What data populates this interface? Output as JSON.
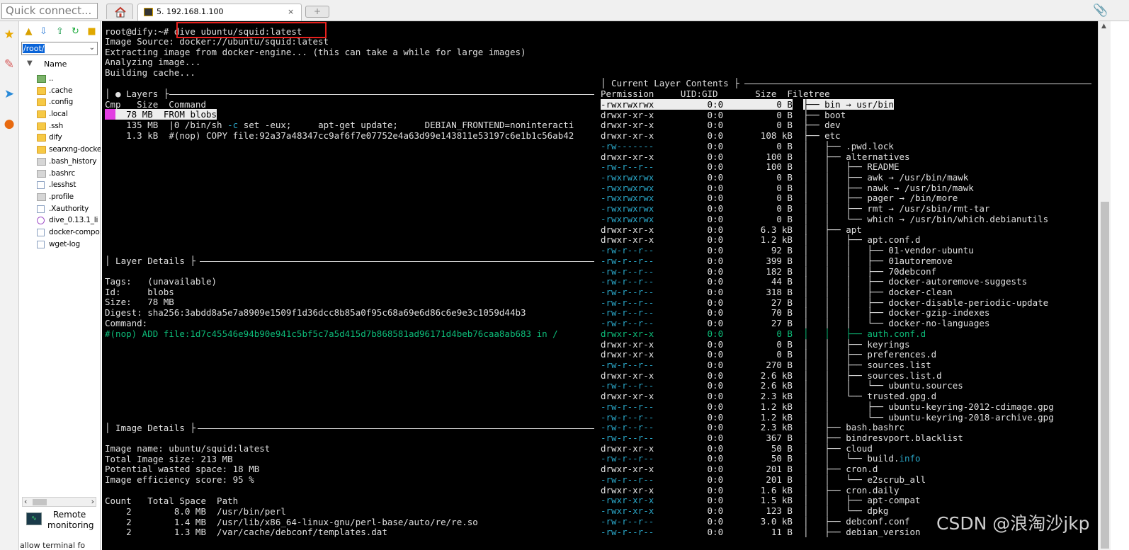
{
  "topbar": {
    "quick_connect_placeholder": "Quick connect...",
    "session_tab_label": "5. 192.168.1.100",
    "close_glyph": "×",
    "new_tab_glyph": "+",
    "attach_icon": "paperclip-icon"
  },
  "browser": {
    "path": "/root/",
    "column_header": "Name",
    "files": [
      {
        "name": "..",
        "kind": "up"
      },
      {
        "name": ".cache",
        "kind": "folder"
      },
      {
        "name": ".config",
        "kind": "folder"
      },
      {
        "name": ".local",
        "kind": "folder"
      },
      {
        "name": ".ssh",
        "kind": "folder"
      },
      {
        "name": "dify",
        "kind": "folder"
      },
      {
        "name": "searxng-docke",
        "kind": "folder"
      },
      {
        "name": ".bash_history",
        "kind": "filegray"
      },
      {
        "name": ".bashrc",
        "kind": "filegray"
      },
      {
        "name": ".lesshst",
        "kind": "doc"
      },
      {
        "name": ".profile",
        "kind": "filegray"
      },
      {
        "name": ".Xauthority",
        "kind": "doc"
      },
      {
        "name": "dive_0.13.1_li",
        "kind": "dive"
      },
      {
        "name": "docker-compo:",
        "kind": "doc"
      },
      {
        "name": "wget-log",
        "kind": "doc"
      }
    ],
    "remote_line1": "Remote",
    "remote_line2": "monitoring",
    "remote_cut": "allow terminal fo"
  },
  "terminal": {
    "prompt": "root@dify:~# ",
    "command": "dive ubuntu/squid:latest",
    "output": [
      "Image Source: docker://ubuntu/squid:latest",
      "Extracting image from docker-engine... (this can take a while for large images)",
      "Analyzing image...",
      "Building cache..."
    ],
    "layers_title": "│ ● Layers ├",
    "layers_header": "Cmp   Size  Command",
    "layers": [
      {
        "size": "  78 MB",
        "cmd": "FROM blobs"
      },
      {
        "size": " 135 MB",
        "cmd_pre": "|0 /bin/sh ",
        "cmd_flag": "-c",
        "cmd_post": " set -eux;     apt-get update;     DEBIAN_FRONTEND=noninteracti"
      },
      {
        "size": " 1.3 kB",
        "cmd": "#(nop) COPY file:92a37a48347cc9af6f7e07752e4a63d99e143811e53197c6e1b1c56ab42"
      }
    ],
    "layer_details_title": "│ Layer Details ├",
    "layer_details": [
      "Tags:   (unavailable)",
      "Id:     blobs",
      "Size:   78 MB",
      "Digest: sha256:3abdd8a5e7a8909e1509f1d36dcc8b85a0f95c68a69e6d86c6e9e3c1059d44b3",
      "Command:"
    ],
    "layer_command": "#(nop) ADD file:1d7c45546e94b90e941c5bf5c7a5d415d7b868581ad96171d4beb76caa8ab683 in /",
    "image_details_title": "│ Image Details ├",
    "image_details": [
      "Image name: ubuntu/squid:latest",
      "Total Image size: 213 MB",
      "Potential wasted space: 18 MB",
      "Image efficiency score: 95 %"
    ],
    "waste_header": "Count   Total Space  Path",
    "waste_rows": [
      "    2        8.0 MB  /usr/bin/perl",
      "    2        1.4 MB  /usr/lib/x86_64-linux-gnu/perl-base/auto/re/re.so",
      "    2        1.3 MB  /var/cache/debconf/templates.dat"
    ],
    "contents_title": "│ Current Layer Contents ├",
    "contents_header": "Permission     UID:GID       Size  Filetree",
    "contents_rows": [
      {
        "perm": "-rwxrwxrwx",
        "uid": "0:0",
        "size": "0 B",
        "tree": "├── bin → usr/bin",
        "style": "selected"
      },
      {
        "perm": "drwxr-xr-x",
        "uid": "0:0",
        "size": "0 B",
        "tree": "├── boot",
        "style": "normal"
      },
      {
        "perm": "drwxr-xr-x",
        "uid": "0:0",
        "size": "0 B",
        "tree": "├── dev",
        "style": "normal"
      },
      {
        "perm": "drwxr-xr-x",
        "uid": "0:0",
        "size": "108 kB",
        "tree": "├── etc",
        "style": "normal"
      },
      {
        "perm": "-rw-------",
        "uid": "0:0",
        "size": "0 B",
        "tree": "│   ├── .pwd.lock",
        "style": "cyan"
      },
      {
        "perm": "drwxr-xr-x",
        "uid": "0:0",
        "size": "100 B",
        "tree": "│   ├── alternatives",
        "style": "normal"
      },
      {
        "perm": "-rw-r--r--",
        "uid": "0:0",
        "size": "100 B",
        "tree": "│   │   ├── README",
        "style": "cyan"
      },
      {
        "perm": "-rwxrwxrwx",
        "uid": "0:0",
        "size": "0 B",
        "tree": "│   │   ├── awk → /usr/bin/mawk",
        "style": "cyan"
      },
      {
        "perm": "-rwxrwxrwx",
        "uid": "0:0",
        "size": "0 B",
        "tree": "│   │   ├── nawk → /usr/bin/mawk",
        "style": "cyan"
      },
      {
        "perm": "-rwxrwxrwx",
        "uid": "0:0",
        "size": "0 B",
        "tree": "│   │   ├── pager → /bin/more",
        "style": "cyan"
      },
      {
        "perm": "-rwxrwxrwx",
        "uid": "0:0",
        "size": "0 B",
        "tree": "│   │   ├── rmt → /usr/sbin/rmt-tar",
        "style": "cyan"
      },
      {
        "perm": "-rwxrwxrwx",
        "uid": "0:0",
        "size": "0 B",
        "tree": "│   │   └── which → /usr/bin/which.debianutils",
        "style": "cyan"
      },
      {
        "perm": "drwxr-xr-x",
        "uid": "0:0",
        "size": "6.3 kB",
        "tree": "│   ├── apt",
        "style": "normal"
      },
      {
        "perm": "drwxr-xr-x",
        "uid": "0:0",
        "size": "1.2 kB",
        "tree": "│   │   ├── apt.conf.d",
        "style": "normal"
      },
      {
        "perm": "-rw-r--r--",
        "uid": "0:0",
        "size": "92 B",
        "tree": "│   │   │   ├── 01-vendor-ubuntu",
        "style": "cyan"
      },
      {
        "perm": "-rw-r--r--",
        "uid": "0:0",
        "size": "399 B",
        "tree": "│   │   │   ├── 01autoremove",
        "style": "cyan"
      },
      {
        "perm": "-rw-r--r--",
        "uid": "0:0",
        "size": "182 B",
        "tree": "│   │   │   ├── 70debconf",
        "style": "cyan"
      },
      {
        "perm": "-rw-r--r--",
        "uid": "0:0",
        "size": "44 B",
        "tree": "│   │   │   ├── docker-autoremove-suggests",
        "style": "cyan"
      },
      {
        "perm": "-rw-r--r--",
        "uid": "0:0",
        "size": "318 B",
        "tree": "│   │   │   ├── docker-clean",
        "style": "cyan"
      },
      {
        "perm": "-rw-r--r--",
        "uid": "0:0",
        "size": "27 B",
        "tree": "│   │   │   ├── docker-disable-periodic-update",
        "style": "cyan"
      },
      {
        "perm": "-rw-r--r--",
        "uid": "0:0",
        "size": "70 B",
        "tree": "│   │   │   ├── docker-gzip-indexes",
        "style": "cyan"
      },
      {
        "perm": "-rw-r--r--",
        "uid": "0:0",
        "size": "27 B",
        "tree": "│   │   │   └── docker-no-languages",
        "style": "cyan"
      },
      {
        "perm": "drwxr-xr-x",
        "uid": "0:0",
        "size": "0 B",
        "tree": "│   │   ├── auth.conf.d",
        "style": "green"
      },
      {
        "perm": "drwxr-xr-x",
        "uid": "0:0",
        "size": "0 B",
        "tree": "│   │   ├── keyrings",
        "style": "normal"
      },
      {
        "perm": "drwxr-xr-x",
        "uid": "0:0",
        "size": "0 B",
        "tree": "│   │   ├── preferences.d",
        "style": "normal"
      },
      {
        "perm": "-rw-r--r--",
        "uid": "0:0",
        "size": "270 B",
        "tree": "│   │   ├── sources.list",
        "style": "cyan"
      },
      {
        "perm": "drwxr-xr-x",
        "uid": "0:0",
        "size": "2.6 kB",
        "tree": "│   │   ├── sources.list.d",
        "style": "normal"
      },
      {
        "perm": "-rw-r--r--",
        "uid": "0:0",
        "size": "2.6 kB",
        "tree": "│   │   │   └── ubuntu.sources",
        "style": "cyan"
      },
      {
        "perm": "drwxr-xr-x",
        "uid": "0:0",
        "size": "2.3 kB",
        "tree": "│   │   └── trusted.gpg.d",
        "style": "normal"
      },
      {
        "perm": "-rw-r--r--",
        "uid": "0:0",
        "size": "1.2 kB",
        "tree": "│   │       ├── ubuntu-keyring-2012-cdimage.gpg",
        "style": "cyan"
      },
      {
        "perm": "-rw-r--r--",
        "uid": "0:0",
        "size": "1.2 kB",
        "tree": "│   │       └── ubuntu-keyring-2018-archive.gpg",
        "style": "cyan"
      },
      {
        "perm": "-rw-r--r--",
        "uid": "0:0",
        "size": "2.3 kB",
        "tree": "│   ├── bash.bashrc",
        "style": "cyan"
      },
      {
        "perm": "-rw-r--r--",
        "uid": "0:0",
        "size": "367 B",
        "tree": "│   ├── bindresvport.blacklist",
        "style": "cyan"
      },
      {
        "perm": "drwxr-xr-x",
        "uid": "0:0",
        "size": "50 B",
        "tree": "│   ├── cloud",
        "style": "normal"
      },
      {
        "perm": "-rw-r--r--",
        "uid": "0:0",
        "size": "50 B",
        "tree": "│   │   └── build.",
        "tree_suffix": "info",
        "style": "cyan"
      },
      {
        "perm": "drwxr-xr-x",
        "uid": "0:0",
        "size": "201 B",
        "tree": "│   ├── cron.d",
        "style": "normal"
      },
      {
        "perm": "-rw-r--r--",
        "uid": "0:0",
        "size": "201 B",
        "tree": "│   │   └── e2scrub_all",
        "style": "cyan"
      },
      {
        "perm": "drwxr-xr-x",
        "uid": "0:0",
        "size": "1.6 kB",
        "tree": "│   ├── cron.daily",
        "style": "normal"
      },
      {
        "perm": "-rwxr-xr-x",
        "uid": "0:0",
        "size": "1.5 kB",
        "tree": "│   │   ├── apt-compat",
        "style": "cyan"
      },
      {
        "perm": "-rwxr-xr-x",
        "uid": "0:0",
        "size": "123 B",
        "tree": "│   │   └── dpkg",
        "style": "cyan"
      },
      {
        "perm": "-rw-r--r--",
        "uid": "0:0",
        "size": "3.0 kB",
        "tree": "│   ├── debconf.conf",
        "style": "cyan"
      },
      {
        "perm": "-rw-r--r--",
        "uid": "0:0",
        "size": "11 B",
        "tree": "│   ├── debian_version",
        "style": "cyan"
      }
    ]
  },
  "watermark": "CSDN @浪淘沙jkp",
  "colors": {
    "terminal_bg": "#000000",
    "terminal_fg": "#e0e0e0",
    "cyan": "#2aa6c7",
    "green": "#0dbc79",
    "highlight_box": "#e8201d",
    "layer_marker": "#e23ee2"
  }
}
